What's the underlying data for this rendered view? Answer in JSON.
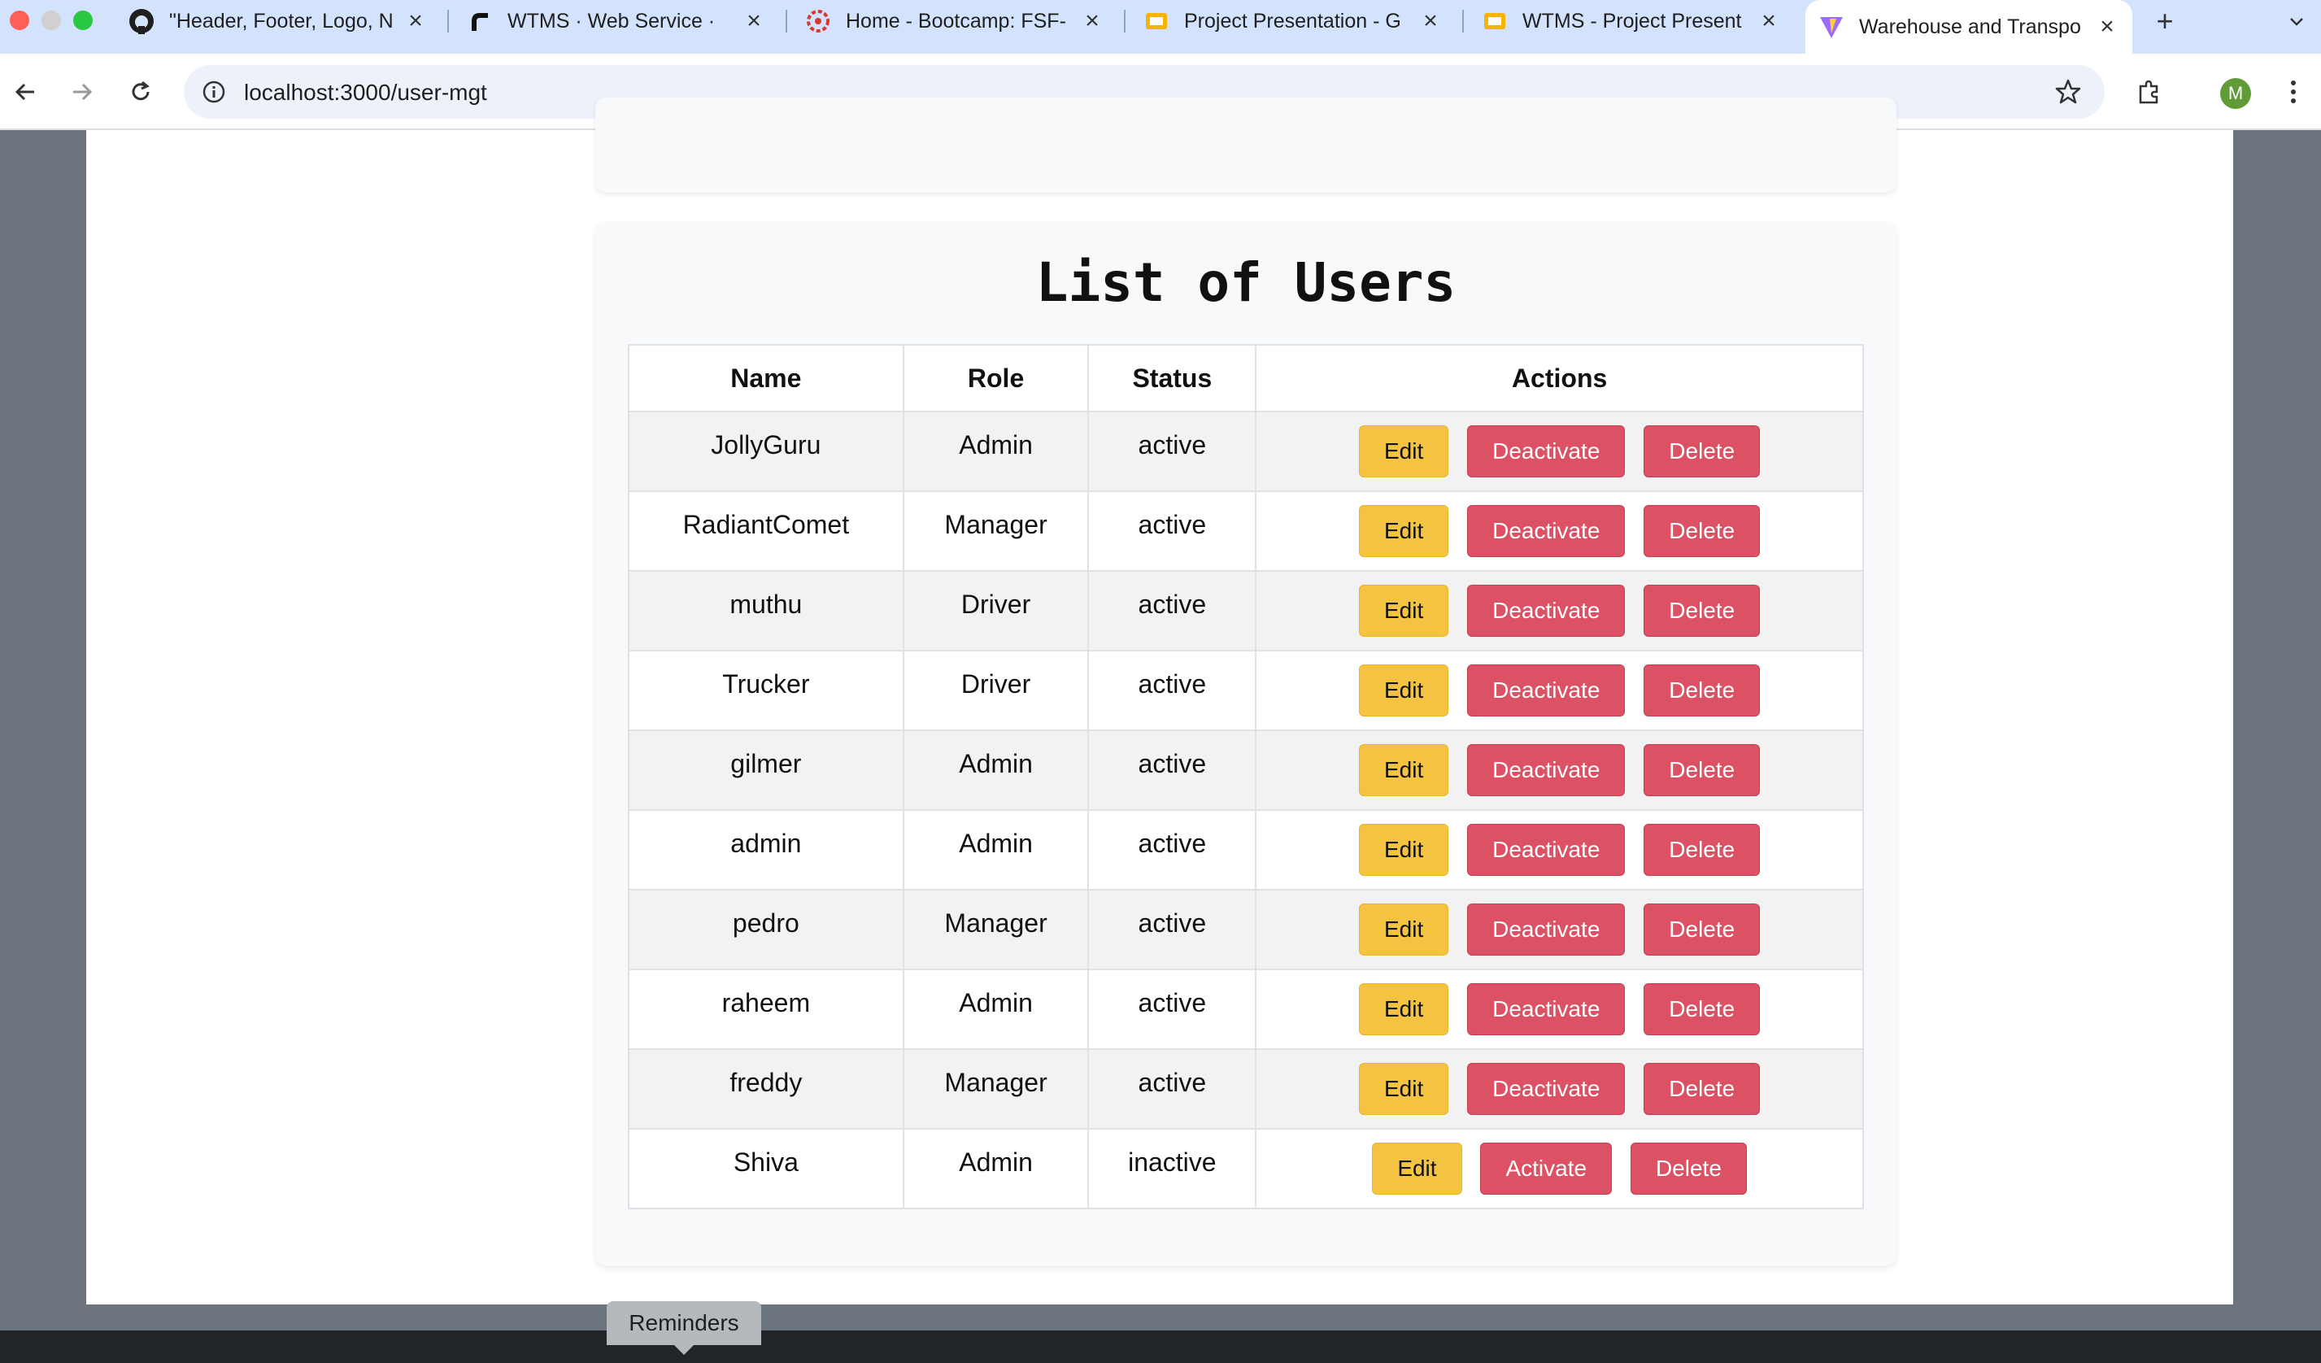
{
  "browser": {
    "tabs": [
      {
        "title": "\"Header, Footer, Logo, N",
        "icon": "github-icon"
      },
      {
        "title": "WTMS · Web Service · ",
        "icon": "render-icon"
      },
      {
        "title": "Home - Bootcamp: FSF-",
        "icon": "bootcamp-icon"
      },
      {
        "title": "Project Presentation - G",
        "icon": "slides-icon"
      },
      {
        "title": "WTMS - Project Present",
        "icon": "slides-icon"
      },
      {
        "title": "Warehouse and Transpo",
        "icon": "vite-icon"
      }
    ],
    "active_tab_index": 5,
    "url": "localhost:3000/user-mgt",
    "profile_initial": "M"
  },
  "page": {
    "title": "List of Users",
    "columns": [
      "Name",
      "Role",
      "Status",
      "Actions"
    ],
    "users": [
      {
        "name": "JollyGuru",
        "role": "Admin",
        "status": "active",
        "toggle_label": "Deactivate"
      },
      {
        "name": "RadiantComet",
        "role": "Manager",
        "status": "active",
        "toggle_label": "Deactivate"
      },
      {
        "name": "muthu",
        "role": "Driver",
        "status": "active",
        "toggle_label": "Deactivate"
      },
      {
        "name": "Trucker",
        "role": "Driver",
        "status": "active",
        "toggle_label": "Deactivate"
      },
      {
        "name": "gilmer",
        "role": "Admin",
        "status": "active",
        "toggle_label": "Deactivate"
      },
      {
        "name": "admin",
        "role": "Admin",
        "status": "active",
        "toggle_label": "Deactivate"
      },
      {
        "name": "pedro",
        "role": "Manager",
        "status": "active",
        "toggle_label": "Deactivate"
      },
      {
        "name": "raheem",
        "role": "Admin",
        "status": "active",
        "toggle_label": "Deactivate"
      },
      {
        "name": "freddy",
        "role": "Manager",
        "status": "active",
        "toggle_label": "Deactivate"
      },
      {
        "name": "Shiva",
        "role": "Admin",
        "status": "inactive",
        "toggle_label": "Activate"
      }
    ],
    "edit_label": "Edit",
    "delete_label": "Delete"
  },
  "reminders_label": "Reminders",
  "colors": {
    "edit_button": "#f5c342",
    "danger_button": "#dc5163",
    "page_background": "#6c757d",
    "tabstrip": "#d3e3fd"
  }
}
